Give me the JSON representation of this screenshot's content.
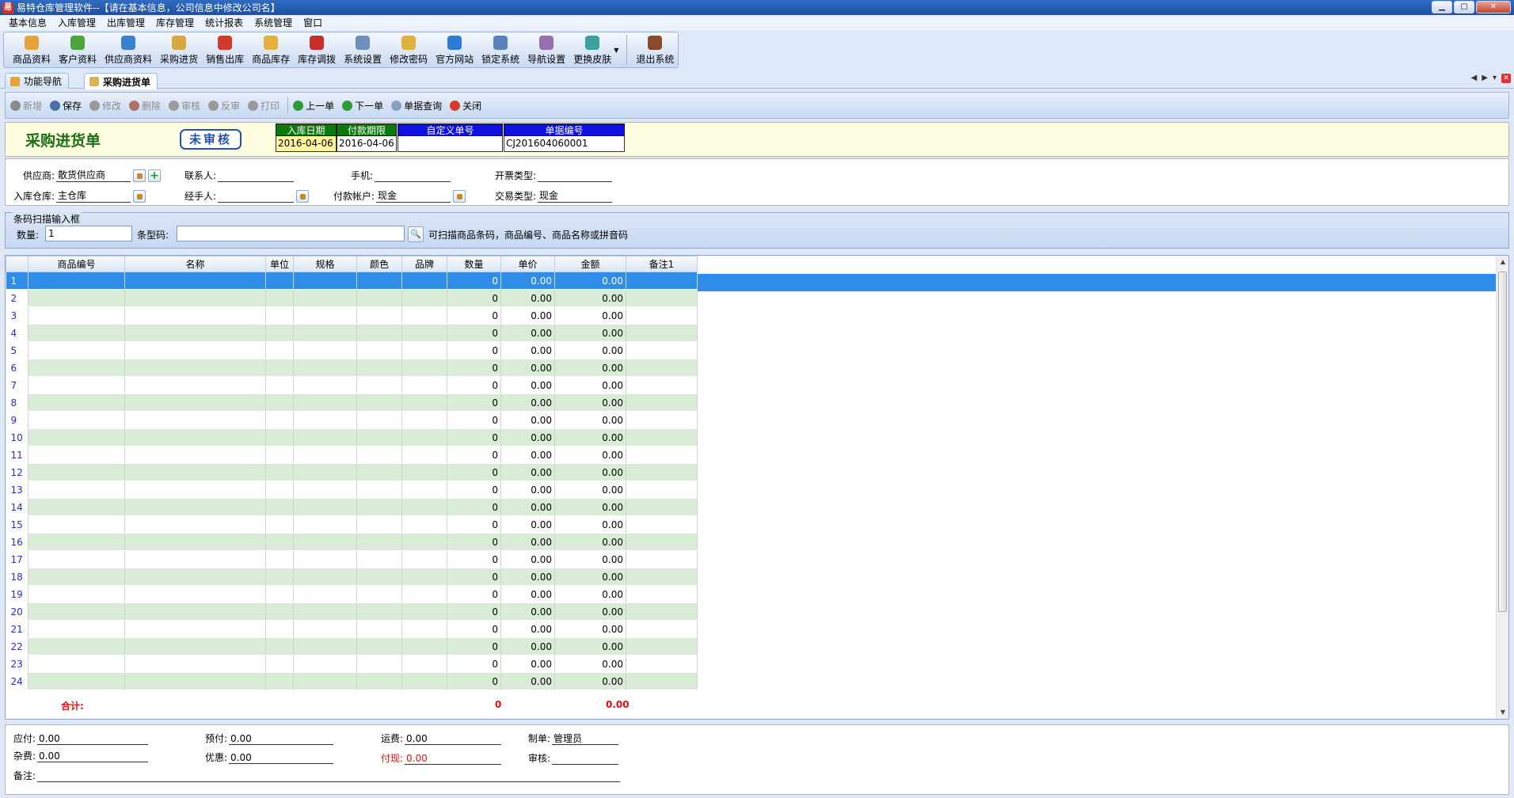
{
  "window": {
    "title": "易特仓库管理软件--【请在基本信息，公司信息中修改公司名】",
    "app_icon": "易",
    "controls": [
      "minimize-icon",
      "maximize-icon",
      "close-icon"
    ]
  },
  "menu": [
    "基本信息",
    "入库管理",
    "出库管理",
    "库存管理",
    "统计报表",
    "系统管理",
    "窗口"
  ],
  "toolbar": [
    {
      "label": "商品资料",
      "icon": "product-icon",
      "color": "#e8a23a"
    },
    {
      "label": "客户资料",
      "icon": "customer-icon",
      "color": "#4aa53a"
    },
    {
      "label": "供应商资料",
      "icon": "supplier-icon",
      "color": "#3a7fd0"
    },
    {
      "label": "采购进货",
      "icon": "truck-icon",
      "color": "#d9a640"
    },
    {
      "label": "销售出库",
      "icon": "cart-icon",
      "color": "#d33a2a"
    },
    {
      "label": "商品库存",
      "icon": "box-icon",
      "color": "#e6b03a"
    },
    {
      "label": "库存调拨",
      "icon": "transfer-icon",
      "color": "#c9302c"
    },
    {
      "label": "系统设置",
      "icon": "settings-icon",
      "color": "#6f8fc0"
    },
    {
      "label": "修改密码",
      "icon": "key-icon",
      "color": "#e1b13a"
    },
    {
      "label": "官方网站",
      "icon": "browser-icon",
      "color": "#2f7cd8"
    },
    {
      "label": "锁定系统",
      "icon": "lock-icon",
      "color": "#5b82b8"
    },
    {
      "label": "导航设置",
      "icon": "navigation-icon",
      "color": "#9a6fb0"
    },
    {
      "label": "更换皮肤",
      "icon": "skin-icon",
      "color": "#3aa0a0"
    },
    {
      "label": "退出系统",
      "icon": "exit-icon",
      "color": "#8a4a2a"
    }
  ],
  "tabs": [
    {
      "label": "功能导航",
      "icon": "home-icon",
      "active": false
    },
    {
      "label": "采购进货单",
      "icon": "document-icon",
      "active": true
    }
  ],
  "actions": [
    {
      "label": "新增",
      "icon": "add-icon",
      "enabled": false
    },
    {
      "label": "保存",
      "icon": "save-icon",
      "enabled": true
    },
    {
      "label": "修改",
      "icon": "edit-icon",
      "enabled": false
    },
    {
      "label": "删除",
      "icon": "delete-icon",
      "enabled": false
    },
    {
      "label": "审核",
      "icon": "audit-icon",
      "enabled": false
    },
    {
      "label": "反审",
      "icon": "unaudit-icon",
      "enabled": false
    },
    {
      "label": "打印",
      "icon": "print-icon",
      "enabled": false
    },
    {
      "label": "上一单",
      "icon": "prev-icon",
      "enabled": true
    },
    {
      "label": "下一单",
      "icon": "next-icon",
      "enabled": true
    },
    {
      "label": "单据查询",
      "icon": "query-icon",
      "enabled": true
    },
    {
      "label": "关闭",
      "icon": "close-icon",
      "enabled": true
    }
  ],
  "header": {
    "doc_title": "采购进货单",
    "status": "未审核",
    "fields": [
      {
        "label": "入库日期",
        "value": "2016-04-06",
        "label_color": "#0a7a0a",
        "value_bg": "#fff59a"
      },
      {
        "label": "付款期限",
        "value": "2016-04-06",
        "label_color": "#0a7a0a",
        "value_bg": "#ffffff"
      },
      {
        "label": "自定义单号",
        "value": "",
        "label_color": "#1010e0",
        "value_bg": "#ffffff"
      },
      {
        "label": "单据编号",
        "value": "CJ201604060001",
        "label_color": "#1010e0",
        "value_bg": "#ffffff"
      }
    ]
  },
  "info": {
    "supplier_label": "供应商:",
    "supplier": "散货供应商",
    "contact_label": "联系人:",
    "contact": "",
    "mobile_label": "手机:",
    "mobile": "",
    "invoice_label": "开票类型:",
    "invoice": "",
    "warehouse_label": "入库仓库:",
    "warehouse": "主仓库",
    "handler_label": "经手人:",
    "handler": "",
    "account_label": "付款帐户:",
    "account": "现金",
    "trade_label": "交易类型:",
    "trade": "现金"
  },
  "barcode": {
    "legend": "条码扫描输入框",
    "qty_label": "数量:",
    "qty": "1",
    "code_label": "条型码:",
    "hint": "可扫描商品条码，商品编号、商品名称或拼音码"
  },
  "grid": {
    "columns": [
      "",
      "商品编号",
      "名称",
      "单位",
      "规格",
      "颜色",
      "品牌",
      "数量",
      "单价",
      "金额",
      "备注1"
    ],
    "rows": [
      {
        "no": "1",
        "qty": "0",
        "price": "0.00",
        "amount": "0.00"
      },
      {
        "no": "2",
        "qty": "0",
        "price": "0.00",
        "amount": "0.00"
      },
      {
        "no": "3",
        "qty": "0",
        "price": "0.00",
        "amount": "0.00"
      },
      {
        "no": "4",
        "qty": "0",
        "price": "0.00",
        "amount": "0.00"
      },
      {
        "no": "5",
        "qty": "0",
        "price": "0.00",
        "amount": "0.00"
      },
      {
        "no": "6",
        "qty": "0",
        "price": "0.00",
        "amount": "0.00"
      },
      {
        "no": "7",
        "qty": "0",
        "price": "0.00",
        "amount": "0.00"
      },
      {
        "no": "8",
        "qty": "0",
        "price": "0.00",
        "amount": "0.00"
      },
      {
        "no": "9",
        "qty": "0",
        "price": "0.00",
        "amount": "0.00"
      },
      {
        "no": "10",
        "qty": "0",
        "price": "0.00",
        "amount": "0.00"
      },
      {
        "no": "11",
        "qty": "0",
        "price": "0.00",
        "amount": "0.00"
      },
      {
        "no": "12",
        "qty": "0",
        "price": "0.00",
        "amount": "0.00"
      },
      {
        "no": "13",
        "qty": "0",
        "price": "0.00",
        "amount": "0.00"
      },
      {
        "no": "14",
        "qty": "0",
        "price": "0.00",
        "amount": "0.00"
      },
      {
        "no": "15",
        "qty": "0",
        "price": "0.00",
        "amount": "0.00"
      },
      {
        "no": "16",
        "qty": "0",
        "price": "0.00",
        "amount": "0.00"
      },
      {
        "no": "17",
        "qty": "0",
        "price": "0.00",
        "amount": "0.00"
      },
      {
        "no": "18",
        "qty": "0",
        "price": "0.00",
        "amount": "0.00"
      },
      {
        "no": "19",
        "qty": "0",
        "price": "0.00",
        "amount": "0.00"
      },
      {
        "no": "20",
        "qty": "0",
        "price": "0.00",
        "amount": "0.00"
      },
      {
        "no": "21",
        "qty": "0",
        "price": "0.00",
        "amount": "0.00"
      },
      {
        "no": "22",
        "qty": "0",
        "price": "0.00",
        "amount": "0.00"
      },
      {
        "no": "23",
        "qty": "0",
        "price": "0.00",
        "amount": "0.00"
      },
      {
        "no": "24",
        "qty": "0",
        "price": "0.00",
        "amount": "0.00"
      }
    ],
    "total_label": "合计:",
    "total_qty": "0",
    "total_amount": "0.00",
    "selected_row": 1
  },
  "footer": {
    "payable_label": "应付:",
    "payable": "0.00",
    "prepaid_label": "预付:",
    "prepaid": "0.00",
    "freight_label": "运费:",
    "freight": "0.00",
    "maker_label": "制单:",
    "maker": "管理员",
    "misc_label": "杂费:",
    "misc": "0.00",
    "discount_label": "优惠:",
    "discount": "0.00",
    "paid_label": "付现:",
    "paid": "0.00",
    "auditor_label": "审核:",
    "auditor": "",
    "remark_label": "备注:",
    "remark": ""
  }
}
